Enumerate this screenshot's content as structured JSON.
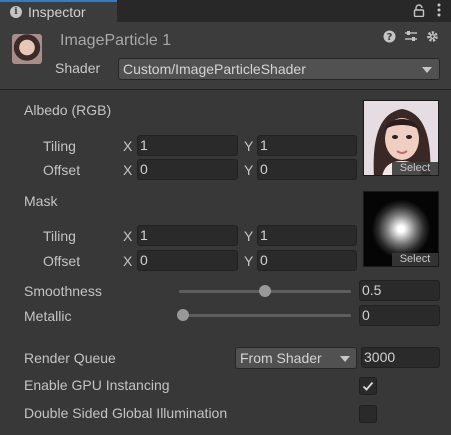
{
  "window": {
    "tab_title": "Inspector"
  },
  "header": {
    "object_name": "ImageParticle 1",
    "shader_label": "Shader",
    "shader_value": "Custom/ImageParticleShader"
  },
  "albedo": {
    "label": "Albedo (RGB)",
    "tiling_label": "Tiling",
    "tiling_x": "1",
    "tiling_y": "1",
    "offset_label": "Offset",
    "offset_x": "0",
    "offset_y": "0",
    "select_label": "Select"
  },
  "mask": {
    "label": "Mask",
    "tiling_label": "Tiling",
    "tiling_x": "1",
    "tiling_y": "1",
    "offset_label": "Offset",
    "offset_x": "0",
    "offset_y": "0",
    "select_label": "Select"
  },
  "axes": {
    "x": "X",
    "y": "Y"
  },
  "smoothness": {
    "label": "Smoothness",
    "value": "0.5",
    "fraction": 0.5
  },
  "metallic": {
    "label": "Metallic",
    "value": "0",
    "fraction": 0.0
  },
  "render_queue": {
    "label": "Render Queue",
    "mode": "From Shader",
    "value": "3000"
  },
  "gpu_instancing": {
    "label": "Enable GPU Instancing",
    "checked": true
  },
  "double_sided_gi": {
    "label": "Double Sided Global Illumination",
    "checked": false
  },
  "colors": {
    "accent": "#3a79bb",
    "background": "#383838",
    "field": "#2a2a2a"
  }
}
